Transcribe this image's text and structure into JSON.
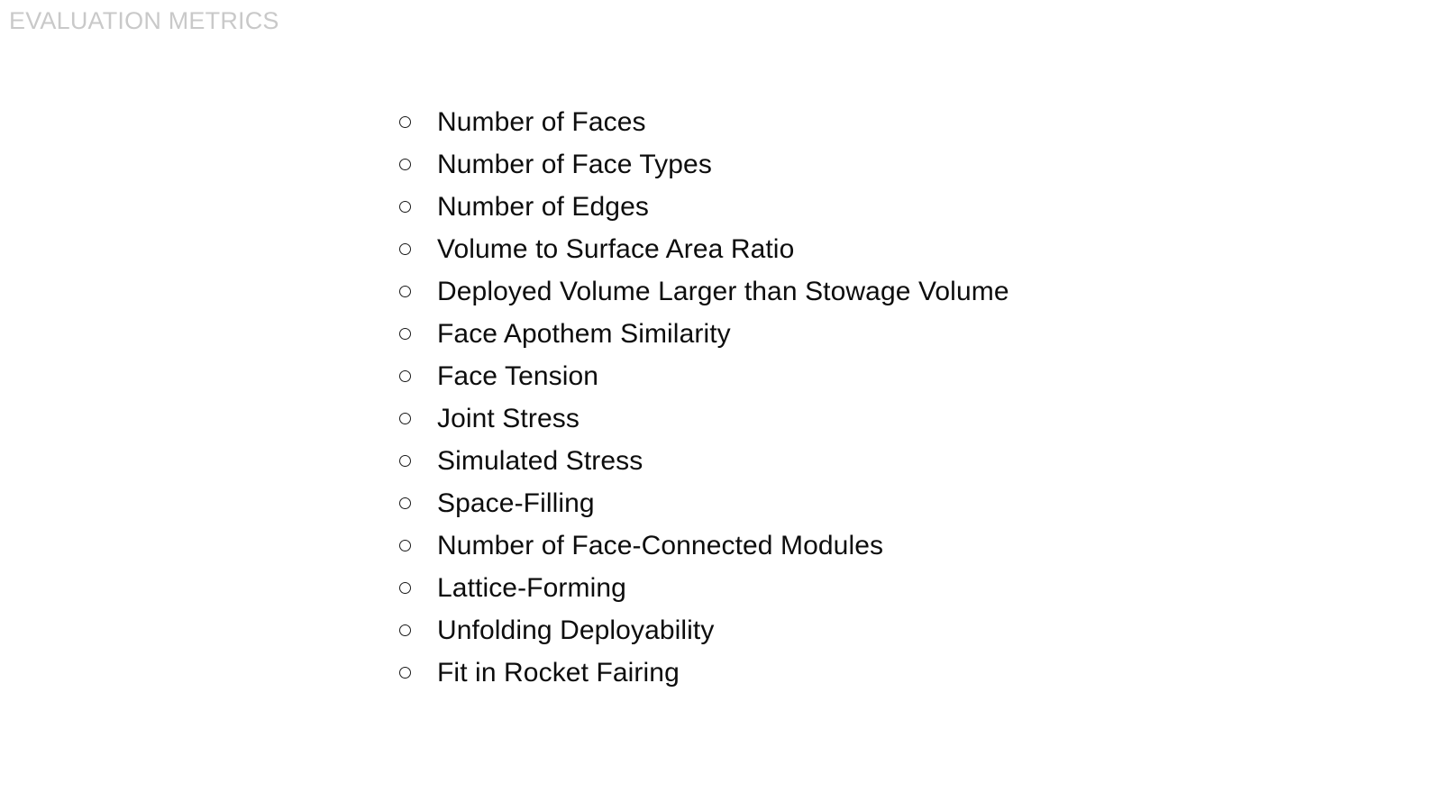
{
  "slide": {
    "title": "EVALUATION METRICS",
    "title_color": "#c9c9c9",
    "background_color": "#ffffff",
    "text_color": "#0d0d0d",
    "bullet_icon": "open-circle-bullet",
    "items": [
      {
        "label": "Number of Faces"
      },
      {
        "label": "Number of Face Types"
      },
      {
        "label": "Number of Edges"
      },
      {
        "label": "Volume to Surface Area Ratio"
      },
      {
        "label": "Deployed Volume Larger than Stowage Volume"
      },
      {
        "label": "Face Apothem Similarity"
      },
      {
        "label": "Face Tension"
      },
      {
        "label": "Joint Stress"
      },
      {
        "label": "Simulated Stress"
      },
      {
        "label": "Space-Filling"
      },
      {
        "label": "Number of Face-Connected Modules"
      },
      {
        "label": "Lattice-Forming"
      },
      {
        "label": "Unfolding Deployability"
      },
      {
        "label": "Fit in Rocket Fairing"
      }
    ]
  }
}
